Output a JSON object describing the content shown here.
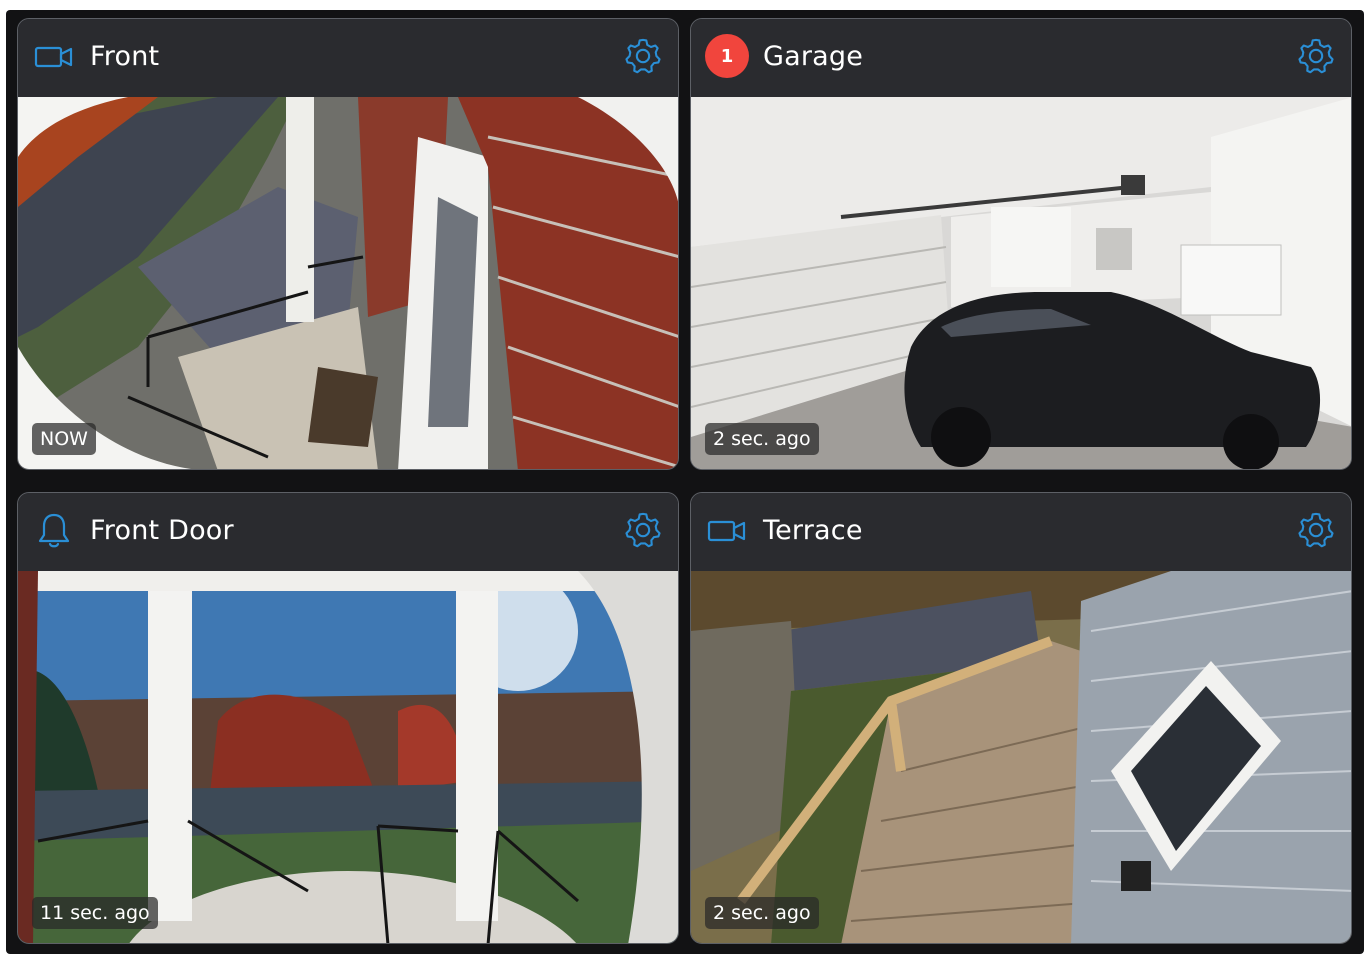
{
  "colors": {
    "accent": "#2a8fd6",
    "badge": "#f1453d",
    "card_bg": "#2a2b2f",
    "background": "#121214"
  },
  "cameras": [
    {
      "name": "Front",
      "icon": "video-camera-icon",
      "timestamp": "NOW"
    },
    {
      "name": "Garage",
      "icon": "alert-badge",
      "badge_count": "1",
      "timestamp": "2 sec. ago"
    },
    {
      "name": "Front Door",
      "icon": "bell-icon",
      "timestamp": "11 sec. ago"
    },
    {
      "name": "Terrace",
      "icon": "video-camera-icon",
      "timestamp": "2 sec. ago"
    }
  ]
}
